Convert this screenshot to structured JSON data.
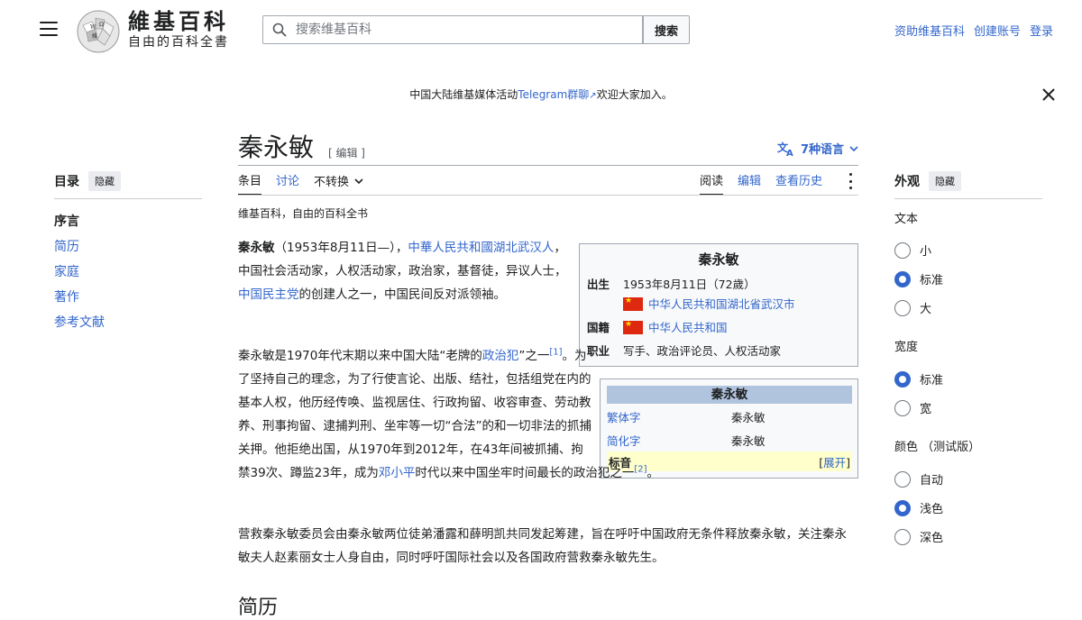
{
  "header": {
    "logo_title": "維基百科",
    "logo_subtitle": "自由的百科全書",
    "search_placeholder": "搜索维基百科",
    "search_button": "搜索",
    "links": [
      "资助维基百科",
      "创建账号",
      "登录"
    ]
  },
  "banner": {
    "before": "中国大陆维基媒体活动",
    "link": "Telegram群聊",
    "after": "欢迎大家加入。"
  },
  "toc": {
    "title": "目录",
    "hide": "隐藏",
    "items": [
      "序言",
      "简历",
      "家庭",
      "著作",
      "参考文献"
    ]
  },
  "article": {
    "title": "秦永敏",
    "edit": "[ 编辑 ]",
    "languages": "7种语言",
    "tabs_left": [
      "条目",
      "讨论",
      "不转换"
    ],
    "tabs_right": [
      "阅读",
      "编辑",
      "查看历史"
    ],
    "tagline": "维基百科，自由的百科全书",
    "p1": {
      "bold": "秦永敏",
      "t1": "（1953年8月11日—），",
      "l1": "中華人民共和國湖北武汉人",
      "t2": "，中国社会活动家，人权活动家，政治家，基督徒，异议人士，",
      "l2": "中国民主党",
      "t3": "的创建人之一，中国民间反对派领袖。"
    },
    "p2": {
      "t1": "秦永敏是1970年代末期以来中国大陆“老牌的",
      "l1": "政治犯",
      "t2": "”之一",
      "ref1": "[1]",
      "t3": "。为了坚持自己的理念，为了行使言论、出版、结社，包括组党在内的基本人权，他历经传唤、监视居住、行政拘留、收容审查、劳动教养、刑事拘留、逮捕判刑、坐牢等一切“合法”的和一切非法的抓捕关押。他拒绝出国，从1970年到2012年，在43年间被抓捕、拘禁39次、蹲监23年，成为",
      "l2": "邓小平",
      "t4": "时代以来中国坐牢时间最长的政治犯之一",
      "ref2": "[2]",
      "t5": "。"
    },
    "p3": "营救秦永敏委员会由秦永敏两位徒弟潘露和薛明凯共同发起筹建，旨在呼吁中国政府无条件释放秦永敏，关注秦永敏夫人赵素丽女士人身自由，同时呼吁国际社会以及各国政府营救秦永敏先生。",
    "next_heading": "简历"
  },
  "infobox": {
    "title": "秦永敏",
    "born_label": "出生",
    "born_value": "1953年8月11日（72歲）",
    "born_place": "中华人民共和国湖北省武汉市",
    "nat_label": "国籍",
    "nat_value": "中华人民共和国",
    "job_label": "职业",
    "job_value": "写手、政治评论员、人权活动家"
  },
  "namebox": {
    "title": "秦永敏",
    "rows": [
      {
        "k": "繁体字",
        "v": "秦永敏"
      },
      {
        "k": "简化字",
        "v": "秦永敏"
      }
    ],
    "foot_label": "标音",
    "foot_bracket_l": "[",
    "foot_action": "展开",
    "foot_bracket_r": "]"
  },
  "appearance": {
    "title": "外观",
    "hide": "隐藏",
    "text_label": "文本",
    "text_options": [
      "小",
      "标准",
      "大"
    ],
    "text_selected": 1,
    "width_label": "宽度",
    "width_options": [
      "标准",
      "宽"
    ],
    "width_selected": 0,
    "color_label": "颜色 （测试版）",
    "color_options": [
      "自动",
      "浅色",
      "深色"
    ],
    "color_selected": 1
  },
  "colors": {
    "link": "#3366cc",
    "radio_on": "#3366cc",
    "namebox_title": "#b0c4de",
    "namebox_foot": "#ffffcc"
  }
}
